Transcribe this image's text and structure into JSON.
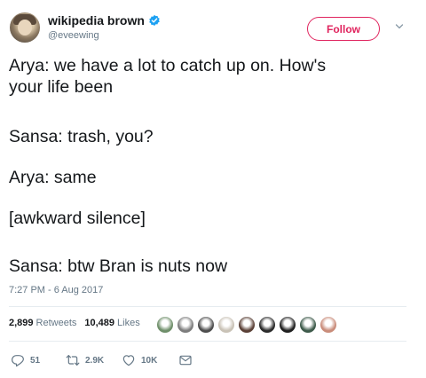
{
  "author": {
    "display_name": "wikipedia brown",
    "handle": "@eveewing",
    "verified": true
  },
  "follow_button": {
    "label": "Follow",
    "color": "#e0245e"
  },
  "tweet": {
    "lines": [
      "Arya: we have a lot to catch up on. How's",
      "your life been",
      "Sansa: trash, you?",
      "Arya: same",
      "[awkward silence]",
      "Sansa: btw Bran is nuts now"
    ],
    "timestamp": "7:27 PM - 6 Aug 2017"
  },
  "stats": {
    "retweets_count": "2,899",
    "retweets_label": "Retweets",
    "likes_count": "10,489",
    "likes_label": "Likes"
  },
  "liker_avatars": [
    {
      "name": "liker-avatar-1",
      "color": "#6f8f6a"
    },
    {
      "name": "liker-avatar-2",
      "color": "#7d7d7d"
    },
    {
      "name": "liker-avatar-3",
      "color": "#4e4e4e"
    },
    {
      "name": "liker-avatar-4",
      "color": "#c9c2b6"
    },
    {
      "name": "liker-avatar-5",
      "color": "#5a4036"
    },
    {
      "name": "liker-avatar-6",
      "color": "#2b2b2b"
    },
    {
      "name": "liker-avatar-7",
      "color": "#1e1e1e"
    },
    {
      "name": "liker-avatar-8",
      "color": "#3d5a4a"
    },
    {
      "name": "liker-avatar-9",
      "color": "#c98c7a"
    }
  ],
  "actions": {
    "reply_count": "51",
    "retweet_count": "2.9K",
    "like_count": "10K"
  },
  "icons": {
    "verified": "verified-badge-icon",
    "caret": "chevron-down-icon",
    "reply": "reply-icon",
    "retweet": "retweet-icon",
    "like": "heart-icon",
    "message": "envelope-icon"
  },
  "colors": {
    "verified_blue": "#1da1f2",
    "secondary_text": "#657786",
    "primary_text": "#14171a"
  }
}
